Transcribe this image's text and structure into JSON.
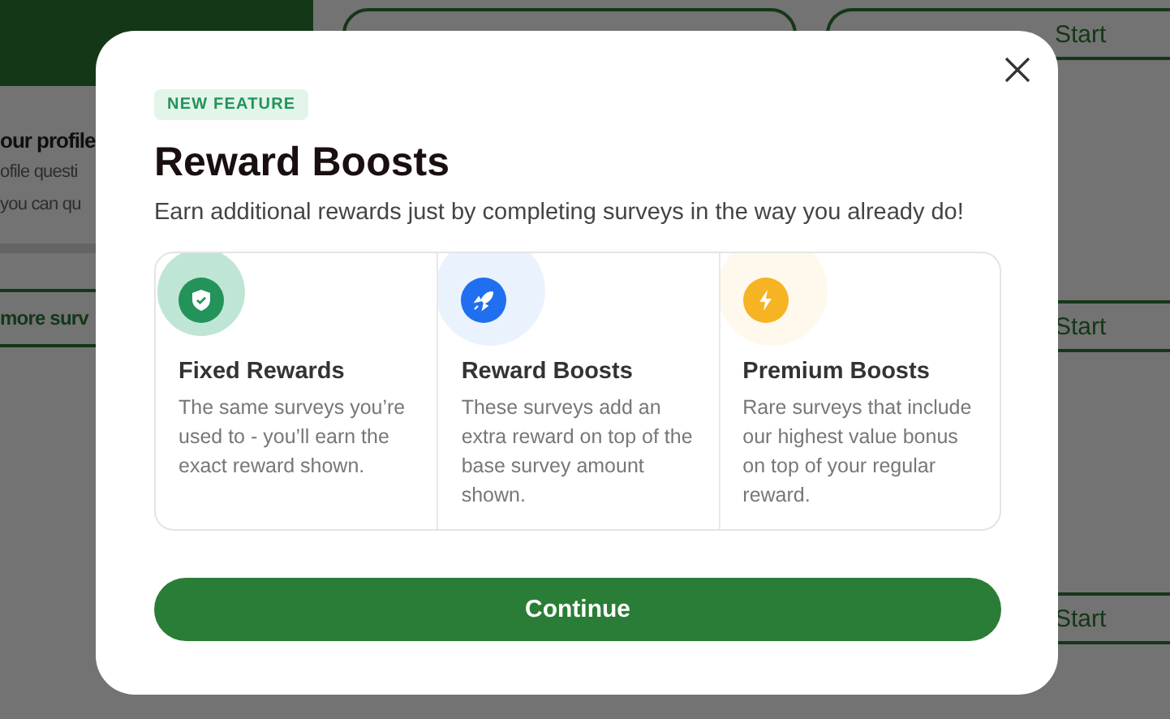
{
  "background": {
    "profile_card": {
      "title": "our profile",
      "lines": [
        "ofile questi",
        "you can qu"
      ],
      "link": "more surv"
    },
    "survey_buttons": [
      "Start",
      "Start",
      "Start"
    ]
  },
  "modal": {
    "badge": "NEW FEATURE",
    "title": "Reward Boosts",
    "subtitle": "Earn additional rewards just by completing surveys in the way you already do!",
    "features": [
      {
        "kind": "fixed",
        "title": "Fixed Rewards",
        "description": "The same surveys you’re used to - you’ll earn the exact reward shown."
      },
      {
        "kind": "boost",
        "title": "Reward Boosts",
        "description": "These surveys add an extra reward on top of the base survey amount shown."
      },
      {
        "kind": "premium",
        "title": "Premium Boosts",
        "description": "Rare surveys that include our highest value bonus on top of your regular reward."
      }
    ],
    "primary_button": "Continue"
  }
}
